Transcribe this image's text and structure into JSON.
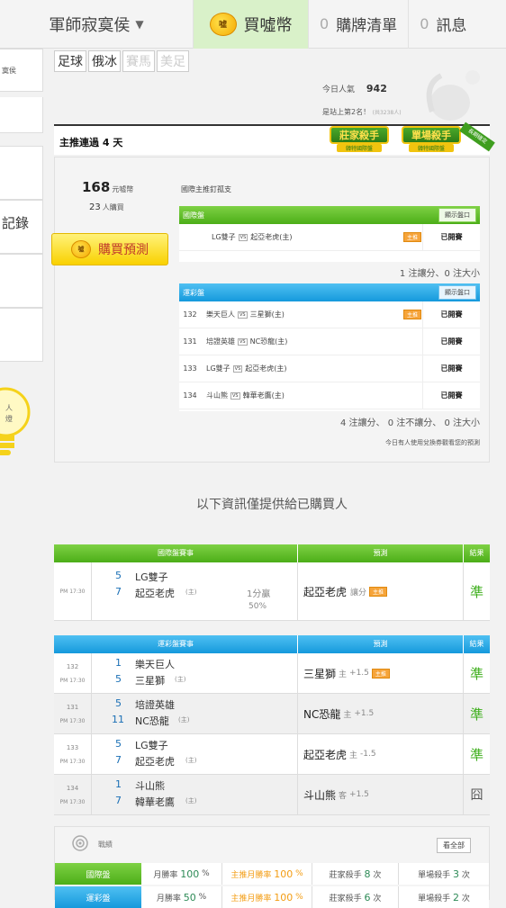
{
  "nav": {
    "username": "軍師寂寞侯",
    "buy_label": "買噓幣",
    "cart_count": "0",
    "cart_label": "購牌清單",
    "msg_count": "0",
    "msg_label": "訊息"
  },
  "sidebar": {
    "user_snippet": "寞侯",
    "record_label": "記錄",
    "bulb_text_1": "人",
    "bulb_text_2": "燈"
  },
  "sport_tabs": [
    {
      "label": "足球",
      "active": true
    },
    {
      "label": "俄冰",
      "active": true
    },
    {
      "label": "賽馬",
      "active": false
    },
    {
      "label": "美足",
      "active": false
    }
  ],
  "stats": {
    "popularity_label": "今日人氣",
    "popularity_value": "942",
    "rank_label": "是站上第2名！",
    "rank_note": "(共3238人)"
  },
  "section": {
    "title": "主推連過 4 天",
    "badge_banker": "莊家殺手",
    "badge_banker_sub": "韓特國際盤",
    "badge_single": "單場殺手",
    "badge_single_sub": "韓特國際盤",
    "badge_ribbon": "長期穩定"
  },
  "prediction": {
    "price": "168",
    "price_unit": "元噓幣",
    "buyers": "23",
    "buyers_unit": "人購買",
    "buy_button": "購買預測",
    "pick_title": "國際主推釘孤支",
    "intl_header": "國際盤",
    "show_odds": "顯示盤口",
    "intl_games": [
      {
        "no": "",
        "away": "LG雙子",
        "home": "起亞老虎(主)",
        "hot": true,
        "status": "已開賽"
      }
    ],
    "intl_summary": "1 注讓分、0 注大小",
    "lottery_header": "運彩盤",
    "lottery_games": [
      {
        "no": "132",
        "away": "樂天巨人",
        "home": "三星獅(主)",
        "hot": true,
        "status": "已開賽"
      },
      {
        "no": "131",
        "away": "培證英雄",
        "home": "NC恐龍(主)",
        "hot": false,
        "status": "已開賽"
      },
      {
        "no": "133",
        "away": "LG雙子",
        "home": "起亞老虎(主)",
        "hot": false,
        "status": "已開賽"
      },
      {
        "no": "134",
        "away": "斗山熊",
        "home": "韓華老鷹(主)",
        "hot": false,
        "status": "已開賽"
      }
    ],
    "lottery_summary": "4 注讓分、 0 注不讓分、 0 注大小",
    "footnote": "今日有人使用兌換券觀看您的預測"
  },
  "info_notice": "以下資訊僅提供給已購買人",
  "intl_table": {
    "header_game": "國際盤賽事",
    "header_pick": "預測",
    "header_result": "結果",
    "rows": [
      {
        "no": "",
        "time": "PM 17:30",
        "s1": "5",
        "t1": "LG雙子",
        "s2": "7",
        "t2": "起亞老虎",
        "home_mark": "(主)",
        "odds1": "1分贏",
        "odds2": "50%",
        "pick": "起亞老虎",
        "pick_type": "讓分",
        "hot": true,
        "result": "準"
      }
    ]
  },
  "lottery_table": {
    "header_game": "運彩盤賽事",
    "header_pick": "預測",
    "header_result": "結果",
    "rows": [
      {
        "no": "132",
        "time": "PM 17:30",
        "s1": "1",
        "t1": "樂天巨人",
        "s2": "5",
        "t2": "三星獅",
        "home_mark": "(主)",
        "pick": "三星獅",
        "pick_side": "主",
        "pick_line": "+1.5",
        "hot": true,
        "result": "準"
      },
      {
        "no": "131",
        "time": "PM 17:30",
        "s1": "5",
        "t1": "培證英雄",
        "s2": "11",
        "t2": "NC恐龍",
        "home_mark": "(主)",
        "pick": "NC恐龍",
        "pick_side": "主",
        "pick_line": "+1.5",
        "hot": false,
        "result": "準"
      },
      {
        "no": "133",
        "time": "PM 17:30",
        "s1": "5",
        "t1": "LG雙子",
        "s2": "7",
        "t2": "起亞老虎",
        "home_mark": "(主)",
        "pick": "起亞老虎",
        "pick_side": "主",
        "pick_line": "-1.5",
        "hot": false,
        "result": "準"
      },
      {
        "no": "134",
        "time": "PM 17:30",
        "s1": "1",
        "t1": "斗山熊",
        "s2": "7",
        "t2": "韓華老鷹",
        "home_mark": "(主)",
        "pick": "斗山熊",
        "pick_side": "客",
        "pick_line": "+1.5",
        "hot": false,
        "result": "囧"
      }
    ]
  },
  "record": {
    "title": "戰績",
    "view_all": "看全部",
    "rows": [
      {
        "label": "國際盤",
        "monthly": "月勝率",
        "monthly_v": "100",
        "pct": "%",
        "main": "主推月勝率",
        "main_v": "100",
        "banker": "莊家殺手",
        "banker_v": "8",
        "single": "單場殺手",
        "single_v": "3",
        "unit": "次"
      },
      {
        "label": "運彩盤",
        "monthly": "月勝率",
        "monthly_v": "50",
        "pct": "%",
        "main": "主推月勝率",
        "main_v": "100",
        "banker": "莊家殺手",
        "banker_v": "6",
        "single": "單場殺手",
        "single_v": "2",
        "unit": "次"
      }
    ]
  },
  "colors": {
    "green": "#4cae18",
    "blue": "#1599dc",
    "orange": "#f39c12",
    "result_green": "#3cae1a"
  }
}
